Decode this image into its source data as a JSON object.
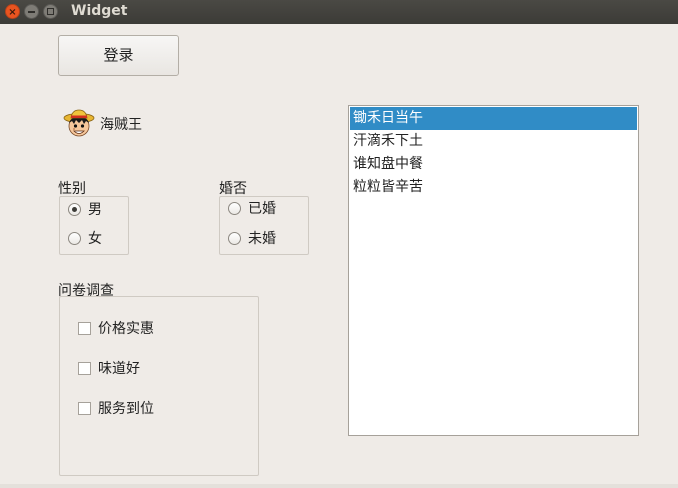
{
  "window": {
    "title": "Widget",
    "close_glyph": "×",
    "min_glyph": "",
    "max_glyph": ""
  },
  "login_button": {
    "label": "登录"
  },
  "avatar": {
    "icon": "one-piece-luffy-icon",
    "name": "海贼王"
  },
  "gender_group": {
    "title": "性别",
    "options": [
      {
        "label": "男",
        "checked": true
      },
      {
        "label": "女",
        "checked": false
      }
    ]
  },
  "marriage_group": {
    "title": "婚否",
    "options": [
      {
        "label": "已婚",
        "checked": false
      },
      {
        "label": "未婚",
        "checked": false
      }
    ]
  },
  "survey_group": {
    "title": "问卷调查",
    "options": [
      {
        "label": "价格实惠",
        "checked": false
      },
      {
        "label": "味道好",
        "checked": false
      },
      {
        "label": "服务到位",
        "checked": false
      }
    ]
  },
  "list": {
    "items": [
      "锄禾日当午",
      "汗滴禾下土",
      "谁知盘中餐",
      "粒粒皆辛苦"
    ],
    "selected_index": 0
  },
  "colors": {
    "selection": "#308cc6",
    "close_button": "#e95420",
    "titlebar": "#3c3b37"
  }
}
